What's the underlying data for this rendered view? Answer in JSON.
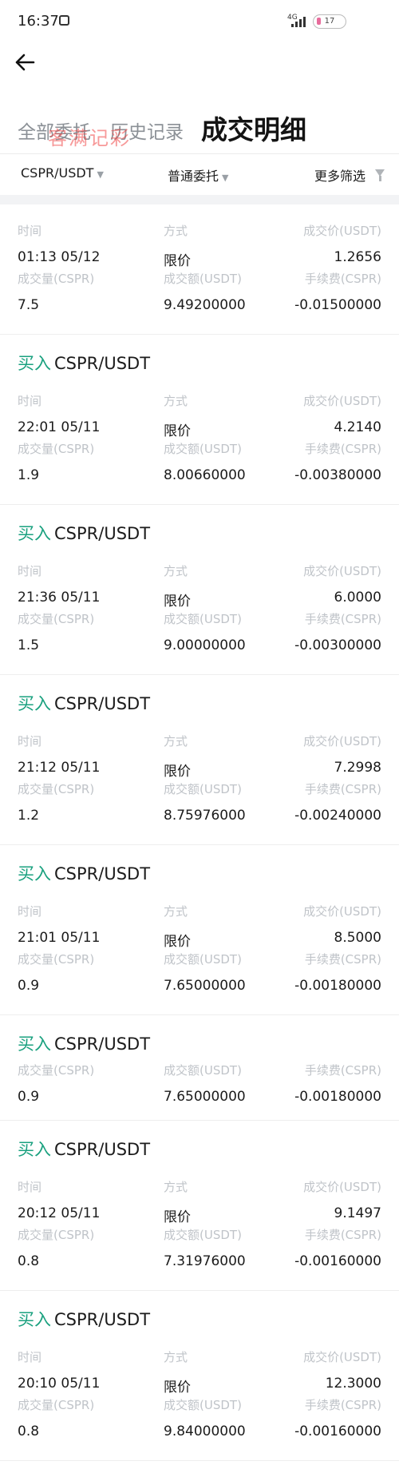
{
  "status_bar": {
    "time": "16:37",
    "network": "4G",
    "battery": "17",
    "icons": [
      "app-notification-icon",
      "signal-icon",
      "battery-icon"
    ]
  },
  "nav": {
    "back_icon": "arrow-left-icon"
  },
  "tabs": [
    {
      "label": "全部委托",
      "active": false
    },
    {
      "label": "历史记录",
      "active": false
    },
    {
      "label": "成交明细",
      "active": true
    }
  ],
  "watermark": "客满记彩",
  "filters": {
    "pair": "CSPR/USDT",
    "order_type": "普通委托",
    "more": "更多筛选",
    "icons": [
      "caret-down-icon",
      "funnel-icon"
    ]
  },
  "colors": {
    "buy": "#1aa17f",
    "label": "#c0c4c9",
    "text": "#1b1b1b",
    "inactive_tab": "#8b9096"
  },
  "labels": {
    "time": "时间",
    "method": "方式",
    "price": "成交价(USDT)",
    "volume": "成交量(CSPR)",
    "amount": "成交额(USDT)",
    "fee": "手续费(CSPR)"
  },
  "records": [
    {
      "side": "",
      "pair": "",
      "time": "01:13 05/12",
      "method": "限价",
      "price": "1.2656",
      "volume": "7.5",
      "amount": "9.49200000",
      "fee": "-0.01500000"
    },
    {
      "side": "买入",
      "pair": "CSPR/USDT",
      "time": "22:01 05/11",
      "method": "限价",
      "price": "4.2140",
      "volume": "1.9",
      "amount": "8.00660000",
      "fee": "-0.00380000"
    },
    {
      "side": "买入",
      "pair": "CSPR/USDT",
      "time": "21:36 05/11",
      "method": "限价",
      "price": "6.0000",
      "volume": "1.5",
      "amount": "9.00000000",
      "fee": "-0.00300000"
    },
    {
      "side": "买入",
      "pair": "CSPR/USDT",
      "time": "21:12 05/11",
      "method": "限价",
      "price": "7.2998",
      "volume": "1.2",
      "amount": "8.75976000",
      "fee": "-0.00240000"
    },
    {
      "side": "买入",
      "pair": "CSPR/USDT",
      "time": "21:01 05/11",
      "method": "限价",
      "price": "8.5000",
      "volume": "0.9",
      "amount": "7.65000000",
      "fee": "-0.00180000"
    },
    {
      "side": "买入",
      "pair": "CSPR/USDT",
      "volume": "0.9",
      "amount": "7.65000000",
      "fee": "-0.00180000"
    },
    {
      "side": "买入",
      "pair": "CSPR/USDT",
      "time": "20:12 05/11",
      "method": "限价",
      "price": "9.1497",
      "volume": "0.8",
      "amount": "7.31976000",
      "fee": "-0.00160000"
    },
    {
      "side": "买入",
      "pair": "CSPR/USDT",
      "time": "20:10 05/11",
      "method": "限价",
      "price": "12.3000",
      "volume": "0.8",
      "amount": "9.84000000",
      "fee": "-0.00160000"
    }
  ]
}
